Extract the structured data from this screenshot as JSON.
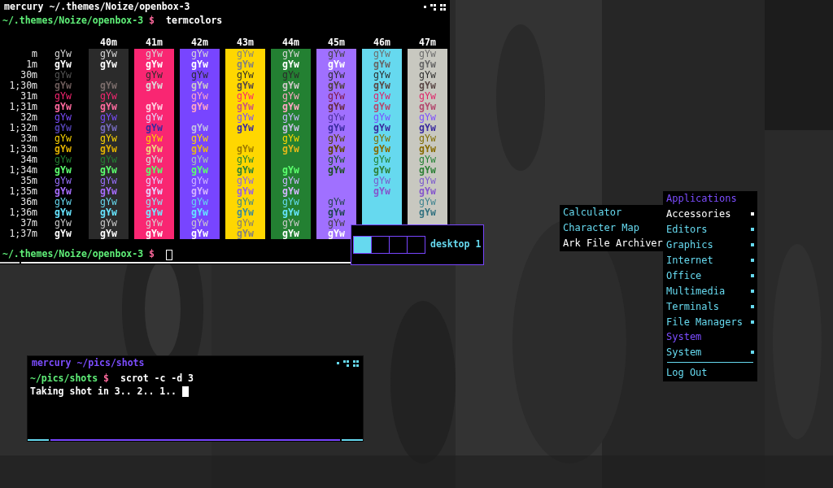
{
  "terminals": [
    {
      "title": "mercury ~/.themes/Noize/openbox-3",
      "focused": false,
      "prompt": {
        "path": "~/.themes/Noize/openbox-3",
        "symbol": "$",
        "command": "termcolors"
      },
      "table": {
        "columns": [
          {
            "label": "40m",
            "color": "#2b2b2b"
          },
          {
            "label": "41m",
            "color": "#f92672"
          },
          {
            "label": "42m",
            "color": "#7845ff"
          },
          {
            "label": "43m",
            "color": "#ffd700"
          },
          {
            "label": "44m",
            "color": "#238032"
          },
          {
            "label": "45m",
            "color": "#a070ff"
          },
          {
            "label": "46m",
            "color": "#66d9ef"
          },
          {
            "label": "47m",
            "color": "#c8c8c0"
          }
        ],
        "rows": [
          {
            "label": "m",
            "color": "#d8d8d8",
            "bold": false,
            "plain": "gYw",
            "cells": [
              "gYw",
              "gYw",
              "gYw",
              "gYw",
              "gYw",
              "gYw",
              "gYw",
              "gYw"
            ]
          },
          {
            "label": "1m",
            "color": "#ffffff",
            "bold": true,
            "plain": "gYw",
            "cells": [
              "gYw",
              "gYw",
              "gYw",
              "gYw",
              "gYw",
              "gYw",
              "gYw",
              "gYw"
            ]
          },
          {
            "label": "30m",
            "color": "#2b2b2b",
            "bold": false,
            "plain": "gYw",
            "cells": [
              null,
              "gYw",
              "gYw",
              "gYw",
              "gYw",
              "gYw",
              "gYw",
              "gYw"
            ]
          },
          {
            "label": "1;30m",
            "color": "#5a4846",
            "bold": true,
            "plain": "gYw",
            "cells": [
              "gYw",
              "gYw",
              "gYw",
              "gYw",
              "gYw",
              "gYw",
              "gYw",
              "gYw"
            ]
          },
          {
            "label": "31m",
            "color": "#f92672",
            "bold": false,
            "plain": "gYw",
            "cells": [
              "gYw",
              null,
              "gYw",
              "gYw",
              "gYw",
              "gYw",
              "gYw",
              "gYw"
            ]
          },
          {
            "label": "1;31m",
            "color": "#ff6a9e",
            "bold": true,
            "plain": "gYw",
            "cells": [
              "gYw",
              "gYw",
              "gYw",
              "gYw",
              "gYw",
              "gYw",
              "gYw",
              "gYw"
            ]
          },
          {
            "label": "32m",
            "color": "#7c4dff",
            "bold": false,
            "plain": "gYw",
            "cells": [
              "gYw",
              "gYw",
              null,
              "gYw",
              "gYw",
              "gYw",
              "gYw",
              "gYw"
            ]
          },
          {
            "label": "1;32m",
            "color": "#3a2a9e",
            "bold": true,
            "plain": "gYw",
            "cells": [
              "gYw",
              "gYw",
              "gYw",
              "gYw",
              "gYw",
              "gYw",
              "gYw",
              "gYw"
            ]
          },
          {
            "label": "33m",
            "color": "#ffd700",
            "bold": false,
            "plain": "gYw",
            "cells": [
              "gYw",
              "gYw",
              "gYw",
              null,
              "gYw",
              "gYw",
              "gYw",
              "gYw"
            ]
          },
          {
            "label": "1;33m",
            "color": "#e0b000",
            "bold": true,
            "plain": "gYw",
            "cells": [
              "gYw",
              "gYw",
              "gYw",
              "gYw",
              "gYw",
              "gYw",
              "gYw",
              "gYw"
            ]
          },
          {
            "label": "34m",
            "color": "#238032",
            "bold": false,
            "plain": "gYw",
            "cells": [
              "gYw",
              "gYw",
              "gYw",
              "gYw",
              null,
              "gYw",
              "gYw",
              "gYw"
            ]
          },
          {
            "label": "1;34m",
            "color": "#5cff6e",
            "bold": true,
            "plain": "gYw",
            "cells": [
              "gYw",
              "gYw",
              "gYw",
              "gYw",
              "gYw",
              "gYw",
              "gYw",
              "gYw"
            ]
          },
          {
            "label": "35m",
            "color": "#9a70ff",
            "bold": false,
            "plain": "gYw",
            "cells": [
              "gYw",
              "gYw",
              "gYw",
              "gYw",
              "gYw",
              null,
              "gYw",
              "gYw"
            ]
          },
          {
            "label": "1;35m",
            "color": "#a66cff",
            "bold": true,
            "plain": "gYw",
            "cells": [
              "gYw",
              "gYw",
              "gYw",
              "gYw",
              "gYw",
              null,
              "gYw",
              "gYw"
            ]
          },
          {
            "label": "36m",
            "color": "#66d9ef",
            "bold": false,
            "plain": "gYw",
            "cells": [
              "gYw",
              "gYw",
              "gYw",
              "gYw",
              "gYw",
              "gYw",
              null,
              "gYw"
            ]
          },
          {
            "label": "1;36m",
            "color": "#66e4ff",
            "bold": true,
            "plain": "gYw",
            "cells": [
              "gYw",
              "gYw",
              "gYw",
              "gYw",
              "gYw",
              "gYw",
              null,
              "gYw"
            ]
          },
          {
            "label": "37m",
            "color": "#cccccc",
            "bold": false,
            "plain": "gYw",
            "cells": [
              "gYw",
              "gYw",
              "gYw",
              "gYw",
              "gYw",
              "gYw",
              null,
              null
            ]
          },
          {
            "label": "1;37m",
            "color": "#ffffff",
            "bold": true,
            "plain": "gYw",
            "cells": [
              "gYw",
              "gYw",
              "gYw",
              "gYw",
              "gYw",
              "gYw",
              null,
              null
            ]
          }
        ]
      },
      "final_prompt": {
        "path": "~/.themes/Noize/openbox-3",
        "symbol": "$"
      }
    },
    {
      "title": "mercury ~/pics/shots",
      "focused": true,
      "prompt": {
        "path": "~/pics/shots",
        "symbol": "$",
        "command": "scrot -c -d 3"
      },
      "output": "Taking shot in 3.. 2.. 1.."
    }
  ],
  "pager": {
    "desktops": [
      {
        "selected": true
      },
      {
        "selected": false
      },
      {
        "selected": false
      },
      {
        "selected": false
      }
    ],
    "label": "desktop 1"
  },
  "submenu": {
    "items": [
      {
        "label": "Calculator",
        "selected": false
      },
      {
        "label": "Character Map",
        "selected": false
      },
      {
        "label": "Ark File Archiver",
        "selected": true
      }
    ]
  },
  "menu": {
    "items": [
      {
        "kind": "header",
        "label": "Applications"
      },
      {
        "kind": "submenu",
        "label": "Accessories",
        "selected": true
      },
      {
        "kind": "submenu",
        "label": "Editors",
        "selected": false
      },
      {
        "kind": "submenu",
        "label": "Graphics",
        "selected": false
      },
      {
        "kind": "submenu",
        "label": "Internet",
        "selected": false
      },
      {
        "kind": "submenu",
        "label": "Office",
        "selected": false
      },
      {
        "kind": "submenu",
        "label": "Multimedia",
        "selected": false
      },
      {
        "kind": "submenu",
        "label": "Terminals",
        "selected": false
      },
      {
        "kind": "submenu",
        "label": "File Managers",
        "selected": false
      },
      {
        "kind": "header",
        "label": "System"
      },
      {
        "kind": "submenu",
        "label": "System",
        "selected": false
      },
      {
        "kind": "separator"
      },
      {
        "kind": "item",
        "label": "Log Out",
        "selected": false
      }
    ]
  }
}
